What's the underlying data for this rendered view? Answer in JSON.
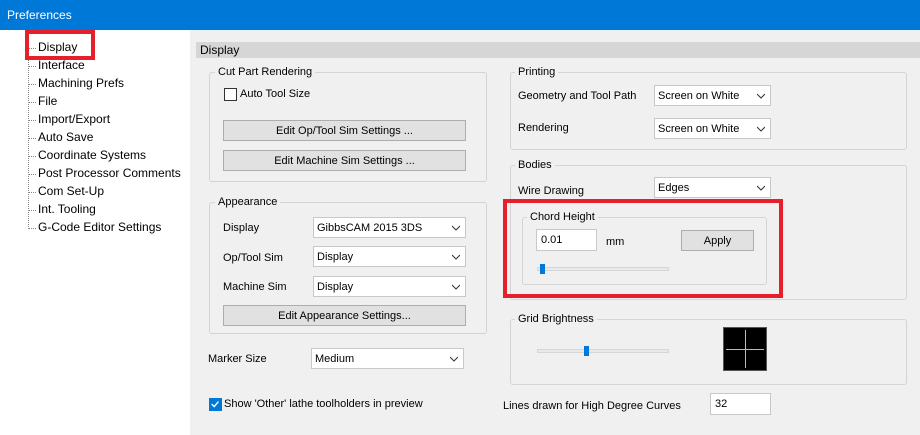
{
  "window": {
    "title": "Preferences"
  },
  "sidebar": {
    "items": [
      {
        "label": "Display"
      },
      {
        "label": "Interface"
      },
      {
        "label": "Machining Prefs"
      },
      {
        "label": "File"
      },
      {
        "label": "Import/Export"
      },
      {
        "label": "Auto Save"
      },
      {
        "label": "Coordinate Systems"
      },
      {
        "label": "Post Processor Comments"
      },
      {
        "label": "Com Set-Up"
      },
      {
        "label": "Int. Tooling"
      },
      {
        "label": "G-Code Editor Settings"
      }
    ]
  },
  "panel": {
    "header": "Display"
  },
  "cut_part": {
    "title": "Cut Part Rendering",
    "auto_tool_size_label": "Auto Tool Size",
    "auto_tool_size_checked": false,
    "edit_op_tool_btn": "Edit Op/Tool Sim Settings ...",
    "edit_machine_btn": "Edit Machine Sim Settings ..."
  },
  "appearance": {
    "title": "Appearance",
    "display_label": "Display",
    "display_value": "GibbsCAM 2015 3DS",
    "op_tool_label": "Op/Tool Sim",
    "op_tool_value": "Display",
    "machine_label": "Machine Sim",
    "machine_value": "Display",
    "edit_btn": "Edit Appearance Settings..."
  },
  "marker": {
    "label": "Marker Size",
    "value": "Medium"
  },
  "show_other": {
    "label": "Show 'Other' lathe toolholders in preview",
    "checked": true
  },
  "printing": {
    "title": "Printing",
    "geometry_label": "Geometry and Tool Path",
    "geometry_value": "Screen on White",
    "rendering_label": "Rendering",
    "rendering_value": "Screen on White"
  },
  "bodies": {
    "title": "Bodies",
    "wire_label": "Wire Drawing",
    "wire_value": "Edges",
    "chord": {
      "title": "Chord Height",
      "value": "0.01",
      "unit": "mm",
      "apply_btn": "Apply",
      "slider_level": 0.02
    }
  },
  "grid": {
    "title": "Grid Brightness",
    "slider_level": 0.37
  },
  "curves": {
    "label": "Lines drawn for High Degree Curves",
    "value": "32"
  },
  "colors": {
    "titlebar": "#0078d7",
    "highlight": "#e5202a",
    "accent": "#0078d7"
  }
}
